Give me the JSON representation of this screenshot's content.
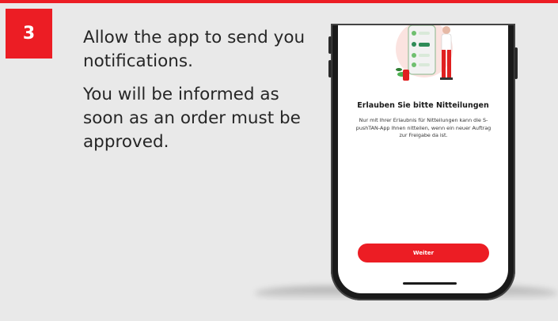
{
  "step": {
    "number": "3",
    "lines": [
      "Allow the app to send you notifications.",
      "You will be informed as soon as an order must be approved."
    ]
  },
  "phone_screen": {
    "title": "Erlauben Sie bitte Nitteilungen",
    "body": "Nur mit Ihrer Erlaubnis für Nitteilungen kann die S-pushTAN-App Ihnen nitteilen, wenn ein neuer Auftrag zur Freigabe da ist.",
    "button_label": "Weiter",
    "illustration": "notification-person-illustration"
  },
  "colors": {
    "accent": "#ec1d24",
    "panel_bg": "#e9e9e9",
    "text": "#262626"
  }
}
